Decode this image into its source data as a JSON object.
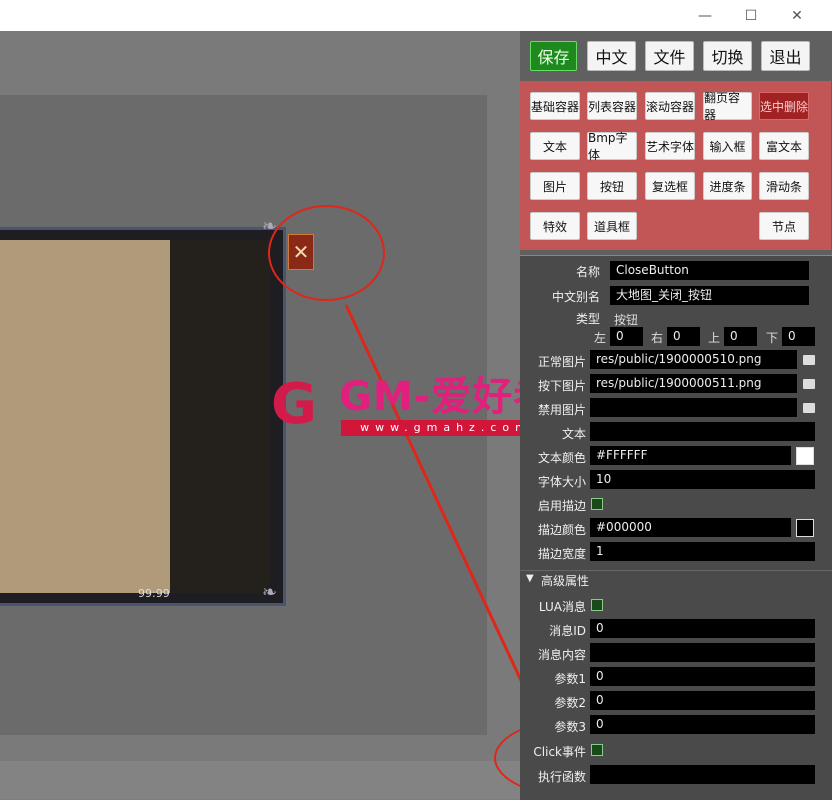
{
  "window": {
    "minimize": "—",
    "maximize": "☐",
    "close": "✕"
  },
  "toolbar": {
    "save": "保存",
    "chinese": "中文",
    "file": "文件",
    "switch": "切换",
    "exit": "退出"
  },
  "widgets": [
    {
      "label": "基础容器"
    },
    {
      "label": "列表容器"
    },
    {
      "label": "滚动容器"
    },
    {
      "label": "翻页容器"
    },
    {
      "label": "选中删除",
      "danger": true
    },
    {
      "label": "文本"
    },
    {
      "label": "Bmp字体"
    },
    {
      "label": "艺术字体"
    },
    {
      "label": "输入框"
    },
    {
      "label": "富文本"
    },
    {
      "label": "图片"
    },
    {
      "label": "按钮"
    },
    {
      "label": "复选框"
    },
    {
      "label": "进度条"
    },
    {
      "label": "滑动条"
    },
    {
      "label": "特效"
    },
    {
      "label": "道具框"
    },
    {
      "label": "节点"
    }
  ],
  "canvas": {
    "frame_value": "99:99",
    "close_glyph": "✕"
  },
  "watermark": {
    "logo_letter": "G",
    "brand": "GM-爱好者",
    "url": "www.gmahz.com"
  },
  "props": {
    "name_label": "名称",
    "name_value": "CloseButton",
    "alias_label": "中文别名",
    "alias_value": "大地图_关闭_按钮",
    "type_label": "类型",
    "type_value": "按钮",
    "margins": {
      "left_label": "左",
      "left": "0",
      "right_label": "右",
      "right": "0",
      "top_label": "上",
      "top": "0",
      "bottom_label": "下",
      "bottom": "0"
    },
    "normal_img_label": "正常图片",
    "normal_img": "res/public/1900000510.png",
    "press_img_label": "按下图片",
    "press_img": "res/public/1900000511.png",
    "disabled_img_label": "禁用图片",
    "disabled_img": "",
    "text_label": "文本",
    "text_value": "",
    "text_color_label": "文本颜色",
    "text_color": "#FFFFFF",
    "font_size_label": "字体大小",
    "font_size": "10",
    "outline_enable_label": "启用描边",
    "outline_color_label": "描边颜色",
    "outline_color": "#000000",
    "outline_width_label": "描边宽度",
    "outline_width": "1",
    "advanced_label": "高级属性",
    "lua_msg_label": "LUA消息",
    "msg_id_label": "消息ID",
    "msg_id": "0",
    "msg_content_label": "消息内容",
    "msg_content": "",
    "param1_label": "参数1",
    "param1": "0",
    "param2_label": "参数2",
    "param2": "0",
    "param3_label": "参数3",
    "param3": "0",
    "click_label": "Click事件",
    "exec_label": "执行函数",
    "exec_value": ""
  },
  "colors": {
    "annotation": "#e0261a",
    "widget_panel": "#c25555",
    "save_button": "#1e8a1e"
  }
}
